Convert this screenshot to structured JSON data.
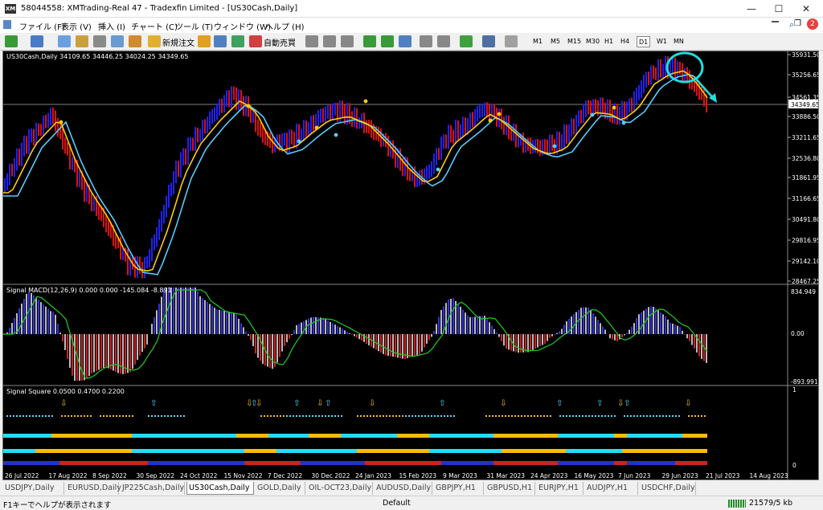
{
  "window": {
    "title": "58044558: XMTrading-Real 47 - Tradexfin Limited - [US30Cash,Daily]",
    "app_icon": "XM",
    "min": "—",
    "max": "☐",
    "close": "✕"
  },
  "menu": [
    "ファイル (F)",
    "表示 (V)",
    "挿入 (I)",
    "チャート (C)",
    "ツール (T)",
    "ウィンドウ (W)",
    "ヘルプ (H)"
  ],
  "notifications": "2",
  "toolbar": {
    "new_order": "新規注文",
    "auto_trade": "自動売買",
    "timeframes": [
      "M1",
      "M5",
      "M15",
      "M30",
      "H1",
      "H4",
      "D1",
      "W1",
      "MN"
    ],
    "active_tf": "D1"
  },
  "chart": {
    "main": {
      "header": "US30Cash,Daily  34109.65 34446.25 34024.25 34349.65",
      "price_labels": [
        "35931.50",
        "35256.65",
        "34561.35",
        "33886.50",
        "33211.65",
        "32536.80",
        "31861.95",
        "31166.65",
        "30491.80",
        "29816.95",
        "29142.10",
        "28467.25"
      ],
      "current_price": "34349.65"
    },
    "macd": {
      "header": "Signal MACD(12,26,9) 0.000 0.000 -145.084 -8.891",
      "labels": [
        "834.949",
        "0.00",
        "-893.991"
      ]
    },
    "square": {
      "header": "Signal Square 0.0500 0.4700 0.2200",
      "labels": [
        "1",
        "0"
      ]
    },
    "date_labels": [
      "26 Jul 2022",
      "17 Aug 2022",
      "8 Sep 2022",
      "30 Sep 2022",
      "24 Oct 2022",
      "15 Nov 2022",
      "7 Dec 2022",
      "30 Dec 2022",
      "24 Jan 2023",
      "15 Feb 2023",
      "9 Mar 2023",
      "31 Mar 2023",
      "24 Apr 2023",
      "16 May 2023",
      "7 Jun 2023",
      "29 Jun 2023",
      "21 Jul 2023",
      "14 Aug 2023"
    ],
    "colors": {
      "bull": "#2222ee",
      "bear": "#dd1111",
      "fast_ma": "#ffcc00",
      "slow_ma": "#55ccff",
      "macd_signal": "#22cc22",
      "highlight": "#22dddd"
    }
  },
  "tabs": [
    "USDJPY,Daily",
    "EURUSD,Daily",
    "JP225Cash,Daily",
    "US30Cash,Daily",
    "GOLD,Daily",
    "OIL-OCT23,Daily",
    "AUDUSD,Daily",
    "GBPJPY,H1",
    "GBPUSD,H1",
    "EURJPY,H1",
    "AUDJPY,H1",
    "USDCHF,Daily"
  ],
  "active_tab": "US30Cash,Daily",
  "status": {
    "help": "F1キーでヘルプが表示されます",
    "profile": "Default",
    "traffic": "21579/5 kb"
  }
}
